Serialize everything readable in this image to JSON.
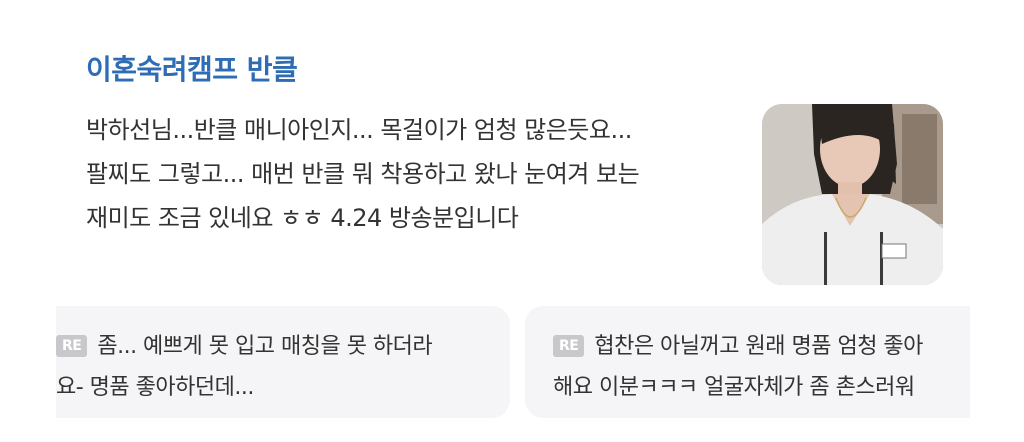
{
  "post": {
    "title": "이혼숙려캠프 반클",
    "body_lines": [
      "박하선님...반클 매니아인지... 목걸이가 엄청 많은듯요...",
      "팔찌도 그렇고... 매번 반클 뭐 착용하고 왔나 눈여겨 보는",
      "재미도 조금 있네요 ㅎㅎ 4.24 방송분입니다"
    ]
  },
  "comments": [
    {
      "badge": "RE",
      "line1": "좀... 예쁘게 못 입고 매칭을 못 하더라",
      "line2": "요- 명품 좋아하던데..."
    },
    {
      "badge": "RE",
      "line1": "협찬은 아닐꺼고 원래 명품 엄청 좋아",
      "line2": "해요 이분ㅋㅋㅋ 얼굴자체가 좀 촌스러워"
    }
  ],
  "colors": {
    "title": "#2e6db4",
    "card_bg": "#f5f5f7",
    "badge_bg": "#c8c8cc"
  }
}
